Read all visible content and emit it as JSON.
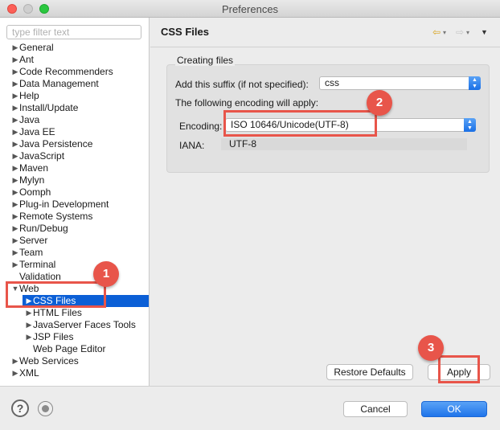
{
  "window": {
    "title": "Preferences"
  },
  "filter": {
    "placeholder": "type filter text"
  },
  "tree": [
    {
      "label": "General",
      "arrow": "▶",
      "level": 0
    },
    {
      "label": "Ant",
      "arrow": "▶",
      "level": 0
    },
    {
      "label": "Code Recommenders",
      "arrow": "▶",
      "level": 0
    },
    {
      "label": "Data Management",
      "arrow": "▶",
      "level": 0
    },
    {
      "label": "Help",
      "arrow": "▶",
      "level": 0
    },
    {
      "label": "Install/Update",
      "arrow": "▶",
      "level": 0
    },
    {
      "label": "Java",
      "arrow": "▶",
      "level": 0
    },
    {
      "label": "Java EE",
      "arrow": "▶",
      "level": 0
    },
    {
      "label": "Java Persistence",
      "arrow": "▶",
      "level": 0
    },
    {
      "label": "JavaScript",
      "arrow": "▶",
      "level": 0
    },
    {
      "label": "Maven",
      "arrow": "▶",
      "level": 0
    },
    {
      "label": "Mylyn",
      "arrow": "▶",
      "level": 0
    },
    {
      "label": "Oomph",
      "arrow": "▶",
      "level": 0
    },
    {
      "label": "Plug-in Development",
      "arrow": "▶",
      "level": 0
    },
    {
      "label": "Remote Systems",
      "arrow": "▶",
      "level": 0
    },
    {
      "label": "Run/Debug",
      "arrow": "▶",
      "level": 0
    },
    {
      "label": "Server",
      "arrow": "▶",
      "level": 0
    },
    {
      "label": "Team",
      "arrow": "▶",
      "level": 0
    },
    {
      "label": "Terminal",
      "arrow": "▶",
      "level": 0
    },
    {
      "label": "Validation",
      "arrow": "",
      "level": 0
    },
    {
      "label": "Web",
      "arrow": "▼",
      "level": 0
    },
    {
      "label": "CSS Files",
      "arrow": "▶",
      "level": 1,
      "selected": true
    },
    {
      "label": "HTML Files",
      "arrow": "▶",
      "level": 1
    },
    {
      "label": "JavaServer Faces Tools",
      "arrow": "▶",
      "level": 1
    },
    {
      "label": "JSP Files",
      "arrow": "▶",
      "level": 1
    },
    {
      "label": "Web Page Editor",
      "arrow": "",
      "level": 1
    },
    {
      "label": "Web Services",
      "arrow": "▶",
      "level": 0
    },
    {
      "label": "XML",
      "arrow": "▶",
      "level": 0
    }
  ],
  "page": {
    "title": "CSS Files",
    "nav": {
      "back_icon": "⇦",
      "forward_icon": "⇨",
      "dropdown_icon": "▾",
      "menu_icon": "▼"
    },
    "group_title": "Creating files",
    "suffix_label": "Add this suffix (if not specified):",
    "suffix_value": "css",
    "encoding_note": "The following encoding will apply:",
    "encoding_label": "Encoding:",
    "encoding_value": "ISO 10646/Unicode(UTF-8)",
    "iana_label": "IANA:",
    "iana_value": "UTF-8",
    "restore_defaults": "Restore Defaults",
    "apply": "Apply"
  },
  "footer": {
    "cancel": "Cancel",
    "ok": "OK",
    "help_icon": "?"
  },
  "annotations": [
    "1",
    "2",
    "3"
  ],
  "colors": {
    "accent": "#1f74ea",
    "selection": "#0b5fd6",
    "callout": "#e8554a"
  }
}
